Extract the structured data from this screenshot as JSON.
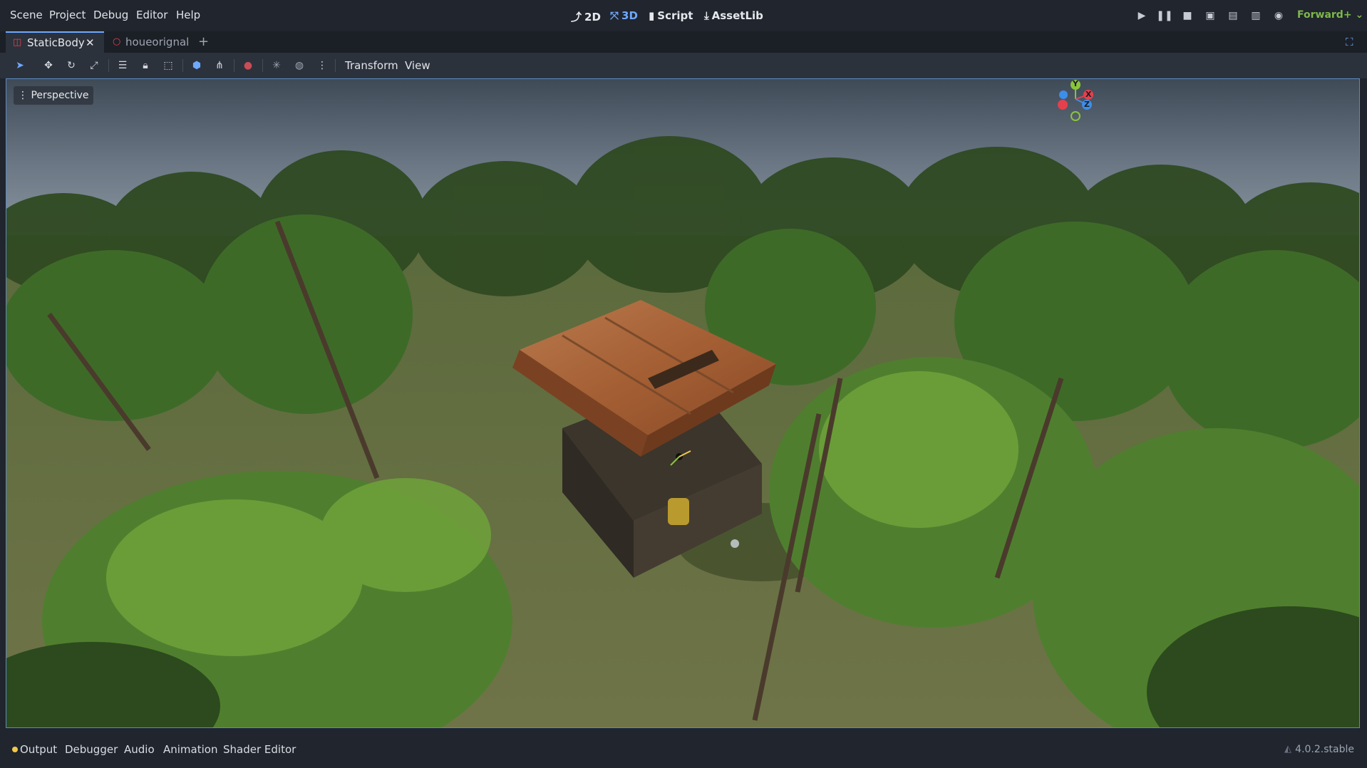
{
  "menubar": {
    "menus": [
      "Scene",
      "Project",
      "Debug",
      "Editor",
      "Help"
    ],
    "workspaces": [
      {
        "label": "2D",
        "icon": "2d-icon"
      },
      {
        "label": "3D",
        "icon": "3d-icon"
      },
      {
        "label": "Script",
        "icon": "script-icon"
      },
      {
        "label": "AssetLib",
        "icon": "assetlib-icon"
      }
    ],
    "playtest": [
      "play-icon",
      "pause-icon",
      "stop-icon",
      "remote-debug-icon",
      "play-scene-icon",
      "play-custom-scene-icon",
      "movie-maker-icon"
    ],
    "renderer": "Forward+"
  },
  "tabs": [
    {
      "label": "StaticBody",
      "active": true
    },
    {
      "label": "houeorignal",
      "active": false
    }
  ],
  "toolbar": {
    "menus": [
      "Transform",
      "View"
    ]
  },
  "viewport": {
    "mode_label": "Perspective",
    "gizmo": {
      "x": "X",
      "y": "Y",
      "z": "Z"
    }
  },
  "bottom": {
    "tabs": [
      "Output",
      "Debugger",
      "Audio",
      "Animation",
      "Shader Editor"
    ],
    "version": "4.0.2.stable"
  },
  "colors": {
    "accent": "#6fa8ff",
    "renderer": "#7eb84a",
    "output_dot": "#f2c84b",
    "axis_x": "#e5404d",
    "axis_y": "#8ac43b",
    "axis_z": "#3d8ee8"
  }
}
